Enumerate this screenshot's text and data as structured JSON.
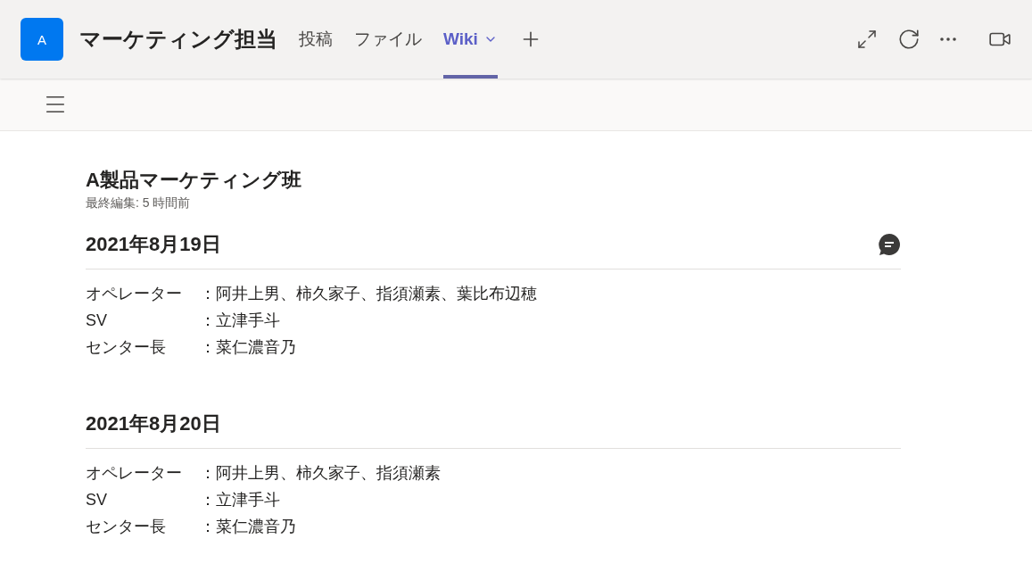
{
  "team": {
    "avatar": "A",
    "name": "マーケティング担当"
  },
  "tabs": [
    {
      "label": "投稿",
      "selected": false,
      "dropdown": false
    },
    {
      "label": "ファイル",
      "selected": false,
      "dropdown": false
    },
    {
      "label": "Wiki",
      "selected": true,
      "dropdown": true
    }
  ],
  "page": {
    "title": "A製品マーケティング班",
    "edited": "最終編集: 5 時間前"
  },
  "sections": [
    {
      "heading": "2021年8月19日",
      "comment": true,
      "rows": [
        {
          "label": "オペレーター",
          "value": "：阿井上男、柿久家子、指須瀬素、葉比布辺穂"
        },
        {
          "label": "SV",
          "value": "：立津手斗"
        },
        {
          "label": "センター長",
          "value": "：菜仁濃音乃"
        }
      ]
    },
    {
      "heading": "2021年8月20日",
      "comment": false,
      "rows": [
        {
          "label": "オペレーター",
          "value": "：阿井上男、柿久家子、指須瀬素"
        },
        {
          "label": "SV",
          "value": "：立津手斗"
        },
        {
          "label": "センター長",
          "value": "：菜仁濃音乃"
        }
      ]
    }
  ]
}
